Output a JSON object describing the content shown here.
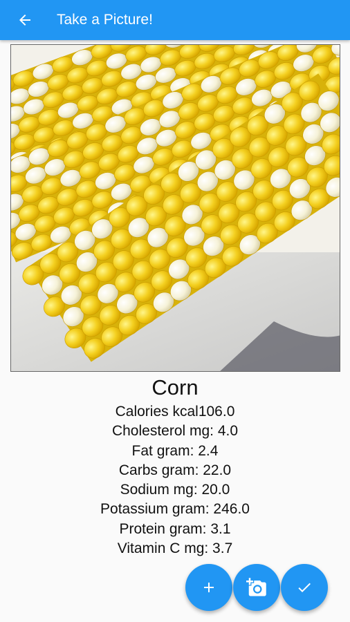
{
  "appbar": {
    "title": "Take a Picture!",
    "back_icon": "arrow-back-icon",
    "color": "#2196f3"
  },
  "photo": {
    "subject": "corn-cob-image"
  },
  "food": {
    "name": "Corn",
    "nutrients": [
      "Calories kcal106.0",
      "Cholesterol mg: 4.0",
      "Fat gram: 2.4",
      "Carbs gram: 22.0",
      "Sodium mg: 20.0",
      "Potassium gram: 246.0",
      "Protein gram: 3.1",
      "Vitamin C mg: 3.7"
    ]
  },
  "fabs": [
    {
      "name": "add-button",
      "icon": "plus-icon"
    },
    {
      "name": "camera-button",
      "icon": "add-camera-icon"
    },
    {
      "name": "confirm-button",
      "icon": "check-icon"
    }
  ]
}
